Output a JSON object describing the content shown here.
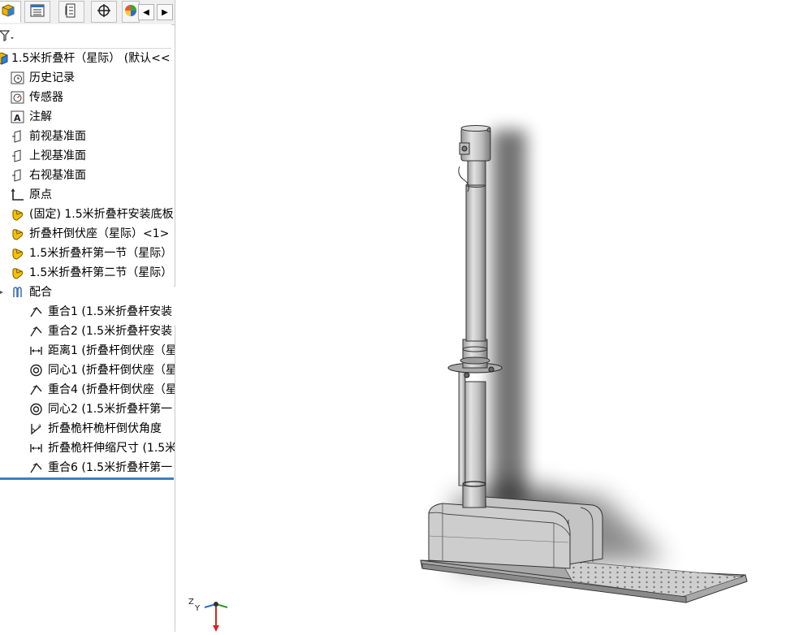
{
  "tabs": [
    {
      "name": "feature-manager-tab",
      "icon": "feature-manager-icon"
    },
    {
      "name": "property-manager-tab",
      "icon": "property-manager-icon"
    },
    {
      "name": "configuration-manager-tab",
      "icon": "configuration-manager-icon"
    },
    {
      "name": "dimxpert-manager-tab",
      "icon": "crosshair-icon"
    },
    {
      "name": "display-manager-tab",
      "icon": "color-wheel-icon"
    }
  ],
  "filter": {
    "icon": "filter-icon"
  },
  "tree": {
    "root": {
      "label": "1.5米折叠杆（星际） (默认<<",
      "icon": "assembly-icon"
    },
    "items": [
      {
        "label": "历史记录",
        "icon": "history-icon"
      },
      {
        "label": "传感器",
        "icon": "sensor-icon"
      },
      {
        "label": "注解",
        "icon": "annotation-icon"
      },
      {
        "label": "前视基准面",
        "icon": "plane-icon"
      },
      {
        "label": "上视基准面",
        "icon": "plane-icon"
      },
      {
        "label": "右视基准面",
        "icon": "plane-icon"
      },
      {
        "label": "原点",
        "icon": "origin-icon"
      },
      {
        "label": "(固定) 1.5米折叠杆安装底板",
        "icon": "part-icon"
      },
      {
        "label": "折叠杆倒伏座（星际）<1>",
        "icon": "part-icon"
      },
      {
        "label": "1.5米折叠杆第一节（星际）",
        "icon": "part-icon"
      },
      {
        "label": "1.5米折叠杆第二节（星际）",
        "icon": "part-icon"
      },
      {
        "label": "配合",
        "icon": "mates-icon"
      }
    ],
    "mates": [
      {
        "label": "重合1 (1.5米折叠杆安装",
        "icon": "coincident-icon"
      },
      {
        "label": "重合2 (1.5米折叠杆安装",
        "icon": "coincident-icon"
      },
      {
        "label": "距离1 (折叠杆倒伏座（星",
        "icon": "distance-icon"
      },
      {
        "label": "同心1 (折叠杆倒伏座（星",
        "icon": "concentric-icon"
      },
      {
        "label": "重合4 (折叠杆倒伏座（星",
        "icon": "coincident-icon"
      },
      {
        "label": "同心2 (1.5米折叠杆第一",
        "icon": "concentric-icon"
      },
      {
        "label": "折叠桅杆桅杆倒伏角度",
        "icon": "angle-icon"
      },
      {
        "label": "折叠桅杆伸缩尺寸 (1.5米",
        "icon": "distance-icon"
      },
      {
        "label": "重合6 (1.5米折叠杆第一",
        "icon": "coincident-icon"
      }
    ]
  },
  "triad": {
    "x": "",
    "y": "Y",
    "z": "Z"
  }
}
